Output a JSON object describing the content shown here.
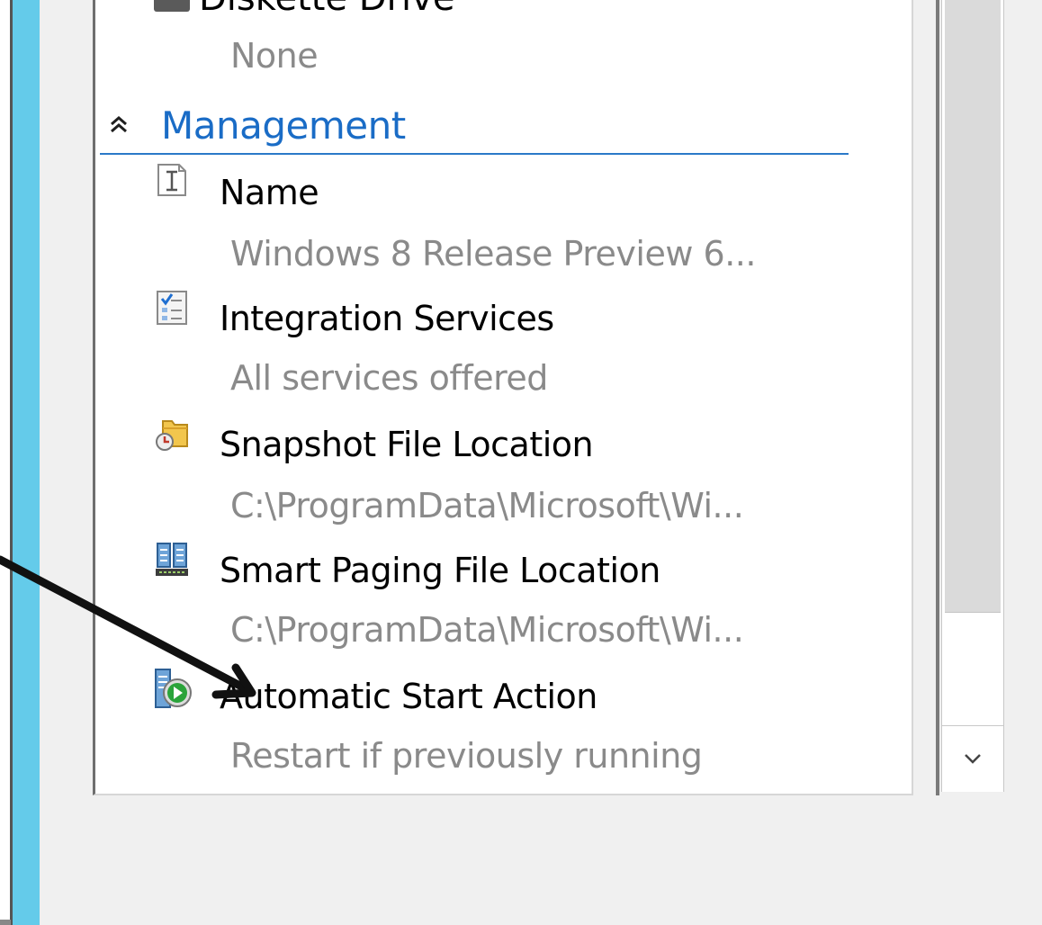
{
  "partial_item": {
    "label": "Diskette Drive",
    "value": "None"
  },
  "section": {
    "title": "Management"
  },
  "items": [
    {
      "label": "Name",
      "value": "Windows 8 Release Preview 6..."
    },
    {
      "label": "Integration Services",
      "value": "All services offered"
    },
    {
      "label": "Snapshot File Location",
      "value": "C:\\ProgramData\\Microsoft\\Wi..."
    },
    {
      "label": "Smart Paging File Location",
      "value": "C:\\ProgramData\\Microsoft\\Wi..."
    },
    {
      "label": "Automatic Start Action",
      "value": "Restart if previously running"
    }
  ],
  "colors": {
    "accent": "#1a6cc6",
    "strip": "#64cbea",
    "value_text": "#8a8a8a"
  },
  "icons": [
    "collapse-chevron-icon",
    "name-text-icon",
    "integration-services-icon",
    "snapshot-folder-icon",
    "smart-paging-icon",
    "automatic-start-icon",
    "scroll-down-icon"
  ]
}
